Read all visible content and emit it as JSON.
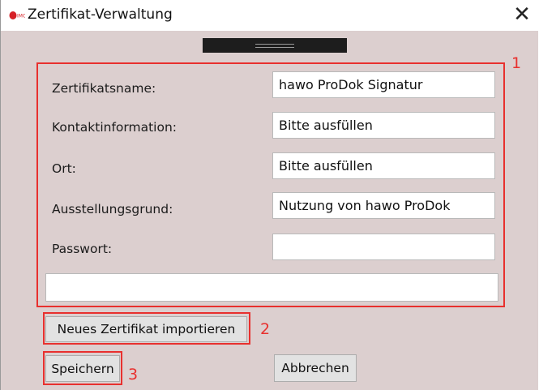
{
  "window": {
    "title": "Zertifikat-Verwaltung",
    "close_glyph": "✕",
    "icon": "app-logo-icon"
  },
  "form": {
    "fields": [
      {
        "label": "Zertifikatsname:",
        "value": "hawo ProDok Signatur"
      },
      {
        "label": "Kontaktinformation:",
        "value": "Bitte ausfüllen"
      },
      {
        "label": "Ort:",
        "value": "Bitte ausfüllen"
      },
      {
        "label": "Ausstellungsgrund:",
        "value": "Nutzung von hawo ProDok"
      },
      {
        "label": "Passwort:",
        "value": ""
      }
    ],
    "extra_field_value": ""
  },
  "buttons": {
    "import": "Neues Zertifikat importieren",
    "save": "Speichern",
    "cancel": "Abbrechen"
  },
  "annotations": {
    "n1": "1",
    "n2": "2",
    "n3": "3",
    "color": "#e8302e"
  },
  "colors": {
    "background": "#dccfcf",
    "grip": "#1d1d1d"
  }
}
